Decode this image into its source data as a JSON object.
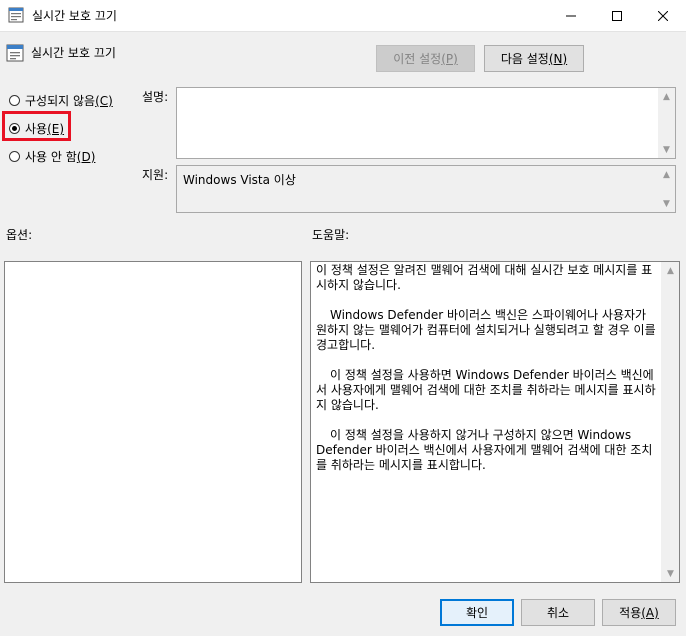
{
  "window": {
    "title": "실시간 보호 끄기",
    "controls": {
      "minimize_icon": "minimize-icon",
      "maximize_icon": "maximize-icon",
      "close_icon": "close-icon"
    }
  },
  "header": {
    "title": "실시간 보호 끄기",
    "prev_button": {
      "text": "이전 설정",
      "mnemonic": "(P)"
    },
    "next_button": {
      "text": "다음 설정",
      "mnemonic": "(N)"
    }
  },
  "state": {
    "options": [
      {
        "text": "구성되지 않음",
        "mnemonic": "(C)",
        "checked": false
      },
      {
        "text": "사용",
        "mnemonic": "(E)",
        "checked": true
      },
      {
        "text": "사용 안 함",
        "mnemonic": "(D)",
        "checked": false
      }
    ]
  },
  "comment": {
    "label": "설명:",
    "value": ""
  },
  "supported": {
    "label": "지원:",
    "value": "Windows Vista 이상"
  },
  "options_pane": {
    "label": "옵션:"
  },
  "help_pane": {
    "label": "도움말:",
    "paragraphs": [
      "이 정책 설정은 알려진 맬웨어 검색에 대해 실시간 보호 메시지를 표시하지 않습니다.",
      "Windows Defender 바이러스 백신은 스파이웨어나 사용자가 원하지 않는 맬웨어가 컴퓨터에 설치되거나 실행되려고 할 경우 이를 경고합니다.",
      "이 정책 설정을 사용하면 Windows Defender 바이러스 백신에서 사용자에게 맬웨어 검색에 대한 조치를 취하라는 메시지를 표시하지 않습니다.",
      "이 정책 설정을 사용하지 않거나 구성하지 않으면 Windows Defender 바이러스 백신에서 사용자에게 맬웨어 검색에 대한 조치를 취하라는 메시지를 표시합니다."
    ]
  },
  "footer": {
    "ok": "확인",
    "cancel": "취소",
    "apply": {
      "text": "적용",
      "mnemonic": "(A)"
    }
  },
  "colors": {
    "highlight": "#e81123",
    "default_button_border": "#0078d7"
  }
}
